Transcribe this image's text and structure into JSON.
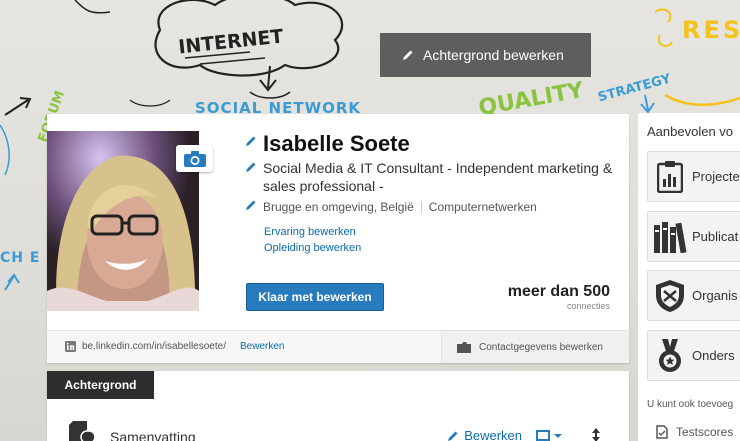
{
  "banner": {
    "edit_background_label": "Achtergrond bewerken",
    "doodles": {
      "internet": "INTERNET",
      "social_network": "SOCIAL NETWORK",
      "quality": "QUALITY",
      "strategy": "STRATEGY",
      "research": "RESE",
      "forum": "FORUM",
      "tech": "CH E"
    }
  },
  "profile": {
    "name": "Isabelle Soete",
    "headline": "Social Media & IT Consultant - Independent marketing & sales professional -",
    "location": "Brugge en omgeving, België",
    "industry": "Computernetwerken",
    "links": [
      "Ervaring bewerken",
      "Opleiding bewerken"
    ],
    "done_button": "Klaar met bewerken",
    "connections_count": "meer dan 500",
    "connections_label": "connecties",
    "public_url": "be.linkedin.com/in/isabellesoete/",
    "url_edit": "Bewerken",
    "contact_edit": "Contactgegevens bewerken"
  },
  "background_section": {
    "tab_label": "Achtergrond",
    "summary_title": "Samenvatting",
    "summary_edit": "Bewerken"
  },
  "rail": {
    "title": "Aanbevolen vo",
    "items": [
      {
        "label": "Projecte",
        "icon": "clipboard-chart-icon"
      },
      {
        "label": "Publicat",
        "icon": "books-icon"
      },
      {
        "label": "Organis",
        "icon": "shield-icon"
      },
      {
        "label": "Onders",
        "icon": "medal-icon"
      }
    ],
    "subtitle": "U kunt ook toevoeg",
    "sub_item": "Testscores"
  },
  "colors": {
    "accent_blue": "#287bbc",
    "link_blue": "#0b6cad",
    "dark_tab": "#2d2d2d",
    "doodle_blue": "#3a9bd5",
    "doodle_green": "#8ac43f",
    "doodle_yellow": "#f5c21b"
  }
}
